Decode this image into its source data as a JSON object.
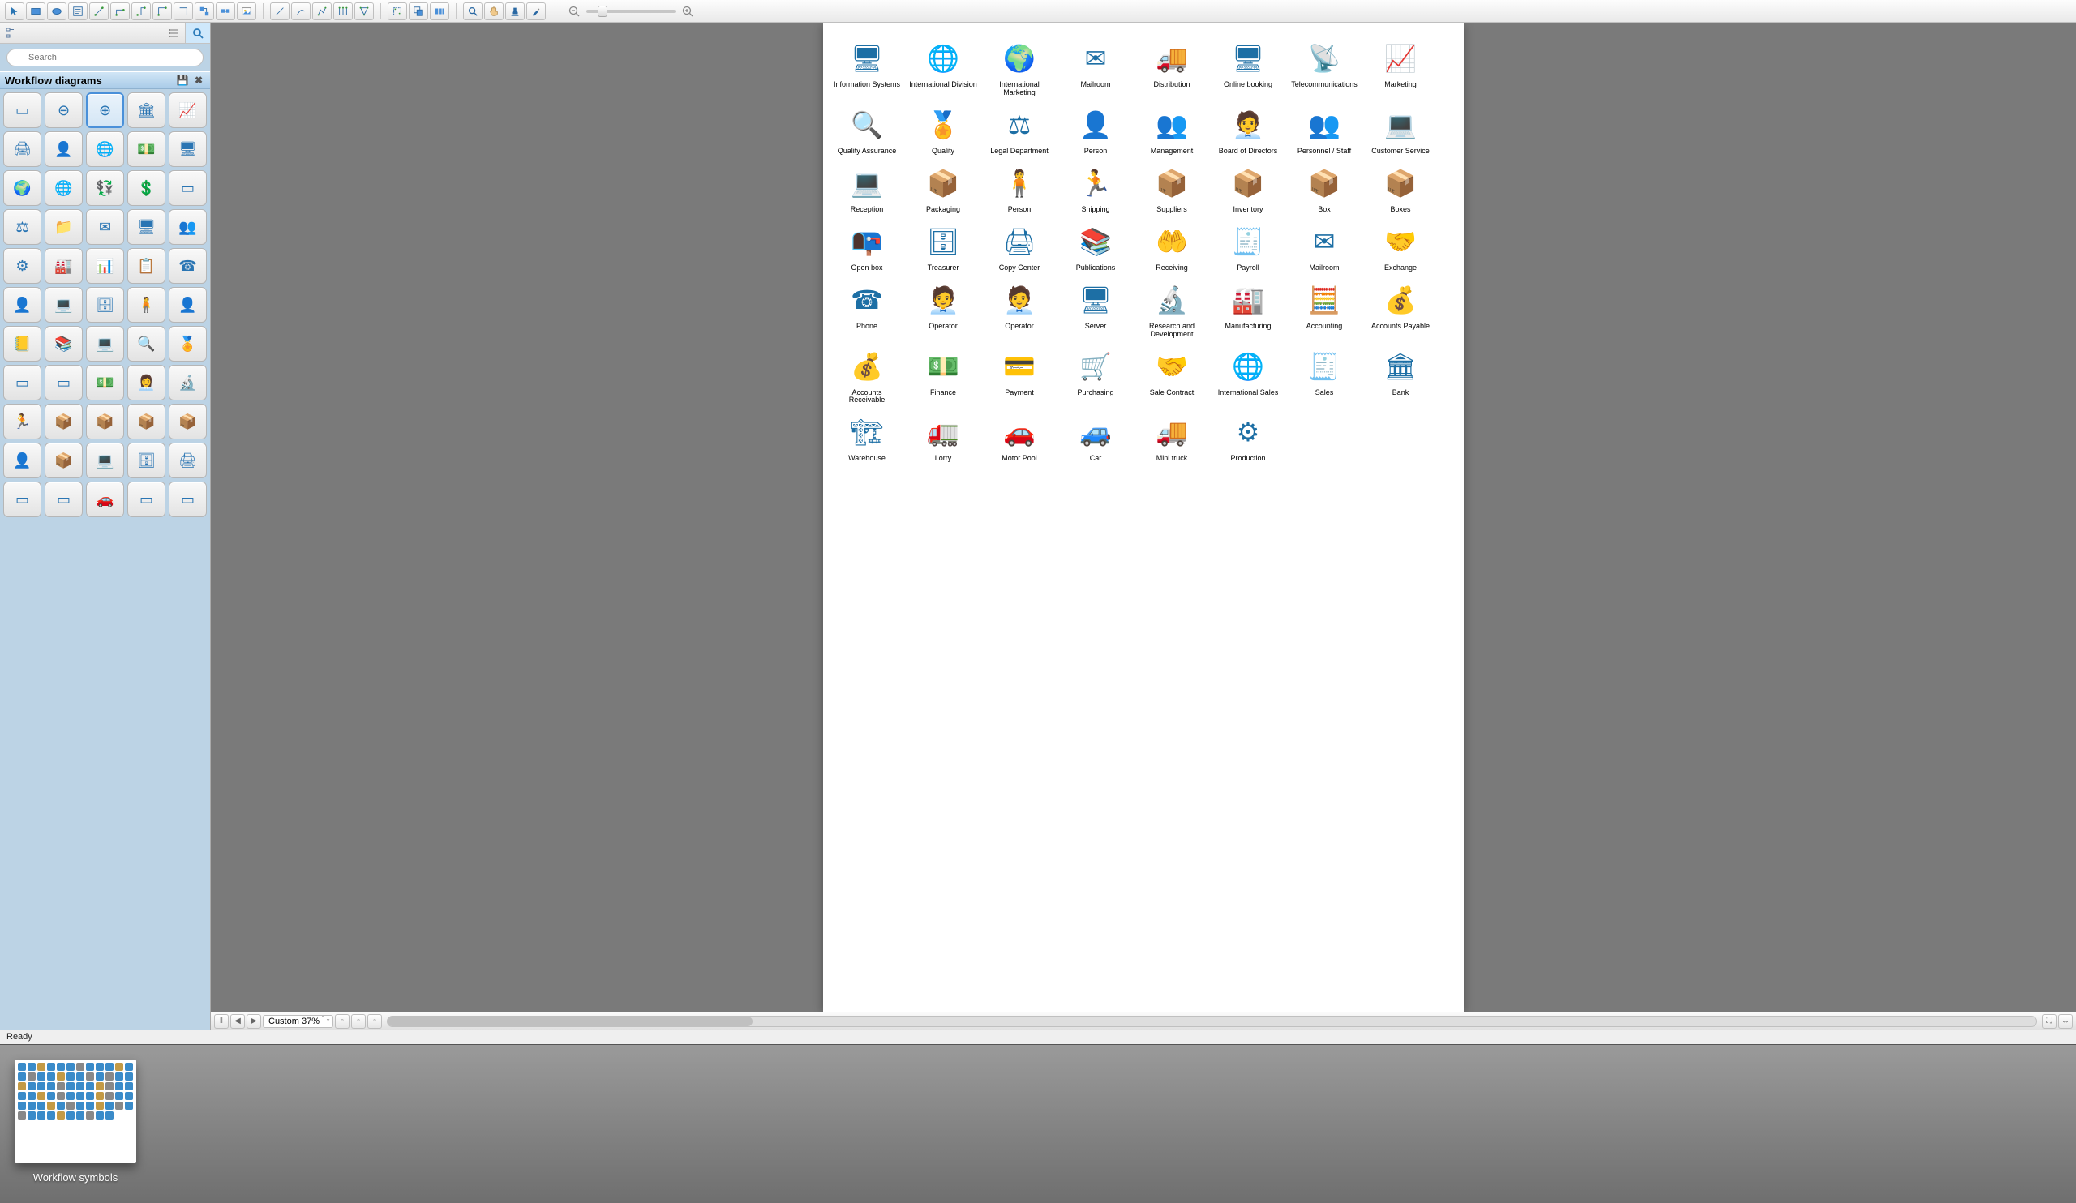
{
  "search": {
    "placeholder": "Search"
  },
  "library": {
    "title": "Workflow diagrams"
  },
  "zoom": {
    "label": "Custom 37%"
  },
  "status": {
    "text": "Ready"
  },
  "preview": {
    "label": "Workflow symbols"
  },
  "canvas_icons": [
    {
      "label": "Information Systems",
      "g": "🖥"
    },
    {
      "label": "International Division",
      "g": "🌐"
    },
    {
      "label": "International Marketing",
      "g": "🌍"
    },
    {
      "label": "Mailroom",
      "g": "✉"
    },
    {
      "label": "Distribution",
      "g": "🚚"
    },
    {
      "label": "Online booking",
      "g": "🖥"
    },
    {
      "label": "Telecommunications",
      "g": "📡"
    },
    {
      "label": "Marketing",
      "g": "📈"
    },
    {
      "label": "Quality Assurance",
      "g": "🔍"
    },
    {
      "label": "Quality",
      "g": "🏅"
    },
    {
      "label": "Legal Department",
      "g": "⚖"
    },
    {
      "label": "Person",
      "g": "👤"
    },
    {
      "label": "Management",
      "g": "👥"
    },
    {
      "label": "Board of Directors",
      "g": "🧑‍💼"
    },
    {
      "label": "Personnel / Staff",
      "g": "👥"
    },
    {
      "label": "Customer Service",
      "g": "💻"
    },
    {
      "label": "Reception",
      "g": "💻"
    },
    {
      "label": "Packaging",
      "g": "📦"
    },
    {
      "label": "Person",
      "g": "🧍"
    },
    {
      "label": "Shipping",
      "g": "🏃"
    },
    {
      "label": "Suppliers",
      "g": "📦"
    },
    {
      "label": "Inventory",
      "g": "📦"
    },
    {
      "label": "Box",
      "g": "📦"
    },
    {
      "label": "Boxes",
      "g": "📦"
    },
    {
      "label": "Open box",
      "g": "📭"
    },
    {
      "label": "Treasurer",
      "g": "🗄"
    },
    {
      "label": "Copy Center",
      "g": "🖨"
    },
    {
      "label": "Publications",
      "g": "📚"
    },
    {
      "label": "Receiving",
      "g": "🤲"
    },
    {
      "label": "Payroll",
      "g": "🧾"
    },
    {
      "label": "Mailroom",
      "g": "✉"
    },
    {
      "label": "Exchange",
      "g": "🤝"
    },
    {
      "label": "Phone",
      "g": "☎"
    },
    {
      "label": "Operator",
      "g": "🧑‍💼"
    },
    {
      "label": "Operator",
      "g": "🧑‍💼"
    },
    {
      "label": "Server",
      "g": "🖥"
    },
    {
      "label": "Research and Development",
      "g": "🔬"
    },
    {
      "label": "Manufacturing",
      "g": "🏭"
    },
    {
      "label": "Accounting",
      "g": "🧮"
    },
    {
      "label": "Accounts Payable",
      "g": "💰"
    },
    {
      "label": "Accounts Receivable",
      "g": "💰"
    },
    {
      "label": "Finance",
      "g": "💵"
    },
    {
      "label": "Payment",
      "g": "💳"
    },
    {
      "label": "Purchasing",
      "g": "🛒"
    },
    {
      "label": "Sale Contract",
      "g": "🤝"
    },
    {
      "label": "International Sales",
      "g": "🌐"
    },
    {
      "label": "Sales",
      "g": "🧾"
    },
    {
      "label": "Bank",
      "g": "🏛"
    },
    {
      "label": "Warehouse",
      "g": "🏗"
    },
    {
      "label": "Lorry",
      "g": "🚛"
    },
    {
      "label": "Motor Pool",
      "g": "🚗"
    },
    {
      "label": "Car",
      "g": "🚙"
    },
    {
      "label": "Mini truck",
      "g": "🚚"
    },
    {
      "label": "Production",
      "g": "⚙"
    }
  ],
  "shape_cells": [
    "▭",
    "⊖",
    "⊕",
    "🏛",
    "📈",
    "🖨",
    "👤",
    "🌐",
    "💵",
    "🖥",
    "🌍",
    "🌐",
    "💱",
    "💲",
    "▭",
    "⚖",
    "📁",
    "✉",
    "🖥",
    "👥",
    "⚙",
    "🏭",
    "📊",
    "📋",
    "☎",
    "👤",
    "💻",
    "🗄",
    "🧍",
    "👤",
    "📒",
    "📚",
    "💻",
    "🔍",
    "🏅",
    "▭",
    "▭",
    "💵",
    "👩‍💼",
    "🔬",
    "🏃",
    "📦",
    "📦",
    "📦",
    "📦",
    "👤",
    "📦",
    "💻",
    "🗄",
    "🖨",
    "▭",
    "▭",
    "🚗",
    "▭",
    "▭"
  ]
}
